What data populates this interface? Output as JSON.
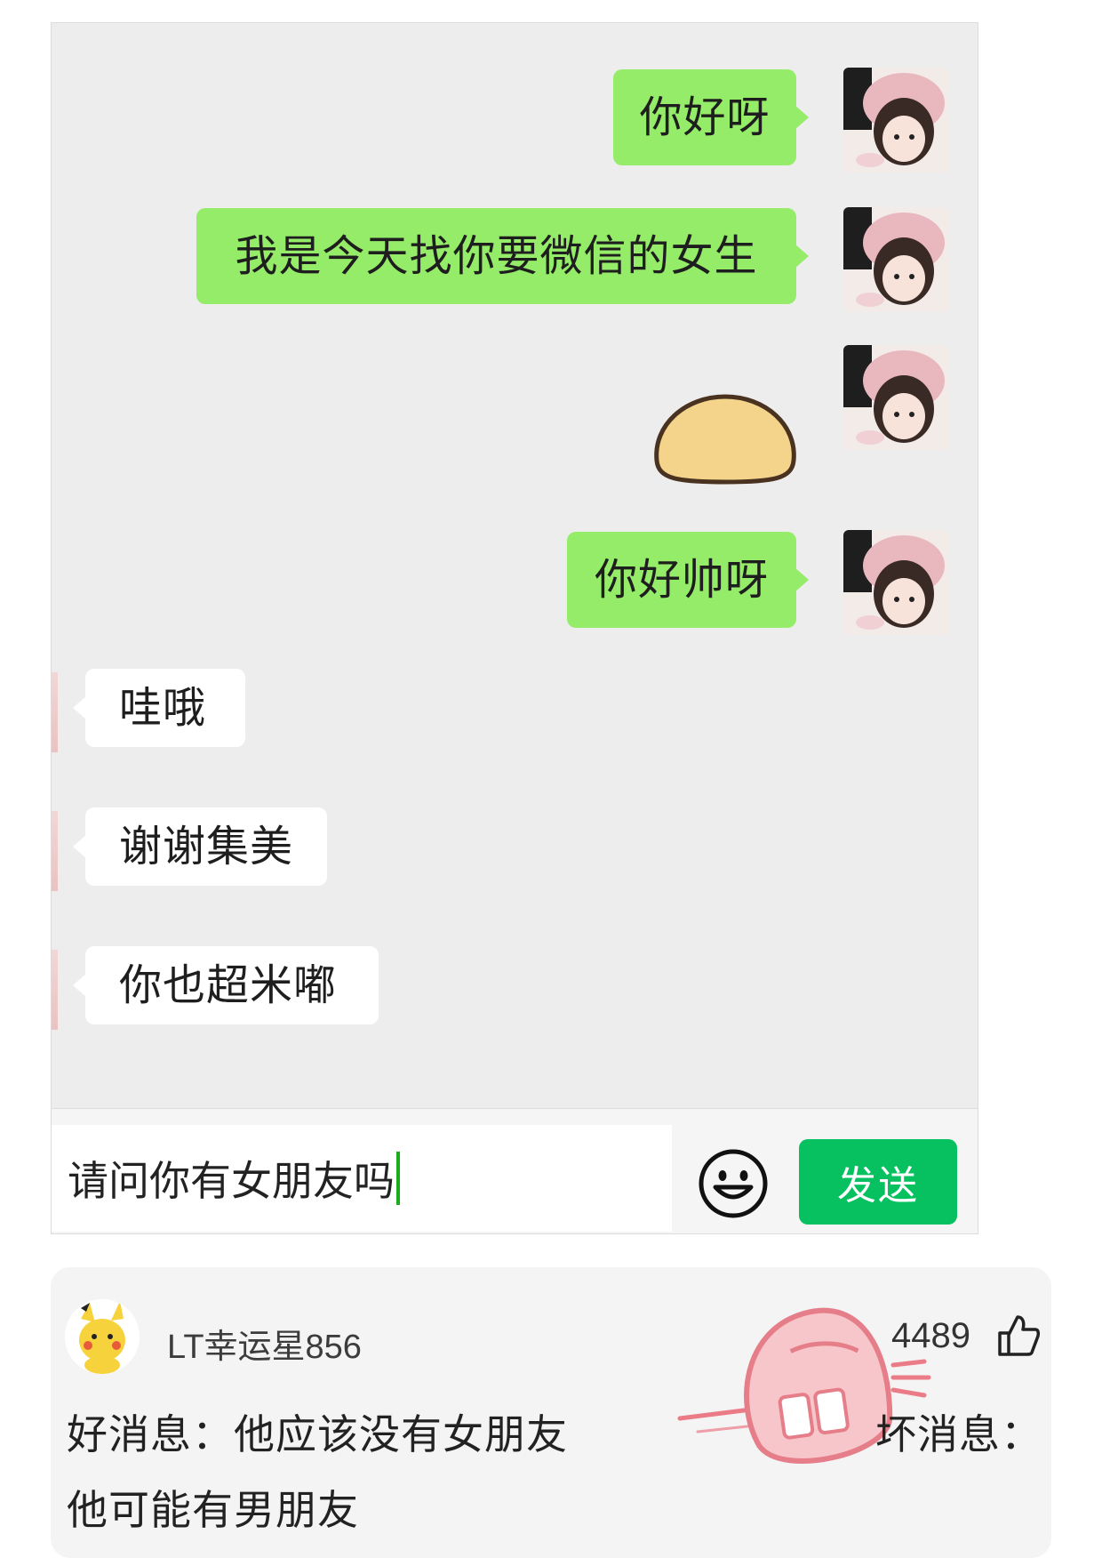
{
  "chat": {
    "outgoing": [
      {
        "text": "你好呀"
      },
      {
        "text": "我是今天找你要微信的女生"
      },
      {
        "sticker": "bread-bun-sticker"
      },
      {
        "text": "你好帅呀"
      }
    ],
    "incoming": [
      {
        "text": "哇哦"
      },
      {
        "text": "谢谢集美"
      },
      {
        "text": "你也超米嘟"
      }
    ],
    "input": {
      "value": "请问你有女朋友吗"
    },
    "emoji_icon": "smiley-face-icon",
    "send_label": "发送"
  },
  "comment": {
    "username": "LT幸运星856",
    "likes": "4489",
    "like_icon": "thumbs-up-icon",
    "good_news": "好消息：他应该没有女朋友",
    "bad_news": "坏消息：",
    "good_news_cont": "他可能有男朋友"
  },
  "colors": {
    "outgoing_bubble": "#95ec69",
    "incoming_bubble": "#ffffff",
    "chat_background": "#ededed",
    "send_button": "#07c160"
  }
}
